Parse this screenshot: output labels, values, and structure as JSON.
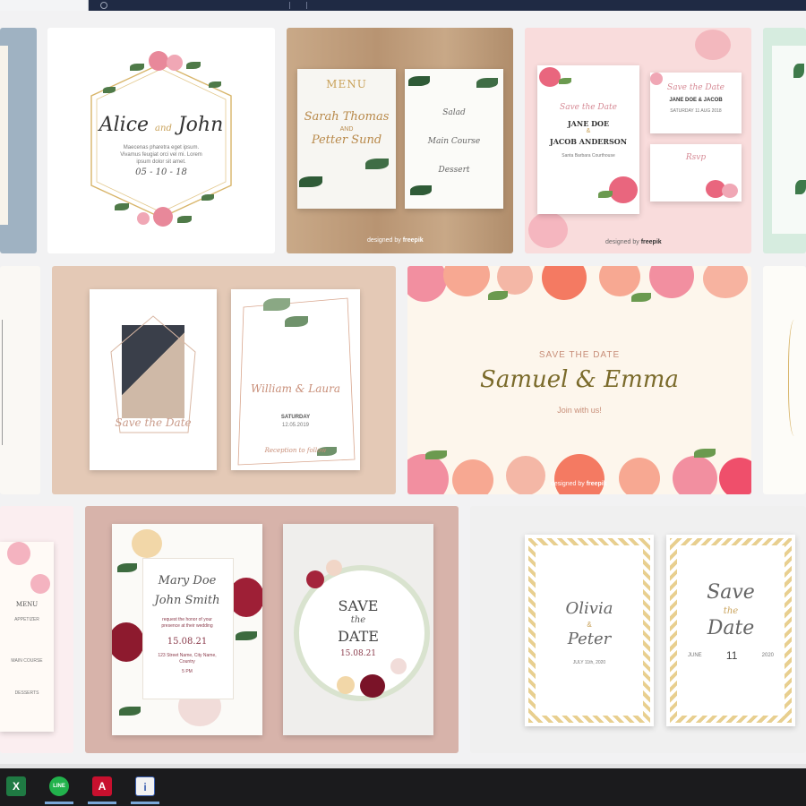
{
  "browser": {
    "tab_icon": "search-icon"
  },
  "thumbnails": {
    "alice": {
      "names": "Alice and John",
      "name1": "Alice",
      "and": "and",
      "name2": "John",
      "body": "Maecenas pharetra eget ipsum. Vivamus feugiat orci vel mi. Lorem ipsum dolor sit amet.",
      "date": "05 - 10 - 18"
    },
    "menu": {
      "menu_label": "MENU",
      "name1": "Sarah Thomas",
      "and": "AND",
      "name2": "Petter Sund",
      "course1": "Salad",
      "course2": "Main Course",
      "course3": "Dessert",
      "credit_prefix": "designed by",
      "credit_brand": "freepik"
    },
    "jane": {
      "save": "Save the Date",
      "name1": "JANE DOE",
      "and": "&",
      "name2": "JACOB ANDERSON",
      "details": "Santa Barbara Courthouse",
      "card2_save": "Save the Date",
      "card2_names": "JANE DOE & JACOB",
      "card2_date": "SATURDAY 11 AUG 2018",
      "rsvp": "Rsvp",
      "credit_prefix": "designed by",
      "credit_brand": "freepik"
    },
    "william": {
      "photo_caption": "Save the Date",
      "names": "William & Laura",
      "day": "SATURDAY",
      "date": "12.05.2019",
      "reception": "Reception to follow"
    },
    "samuel": {
      "save": "SAVE THE DATE",
      "names": "Samuel & Emma",
      "join": "Join with us!",
      "credit_prefix": "designed by",
      "credit_brand": "freepik"
    },
    "menu_left": {
      "menu": "MENU",
      "appetizer": "APPETIZER",
      "main": "MAIN COURSE",
      "desserts": "DESSERTS"
    },
    "mary": {
      "names1": "Mary Doe",
      "names2": "John Smith",
      "invite": "request the honor of your presence at their wedding",
      "date": "15.08.21",
      "address": "123 Street Name, City Name, Country",
      "time": "5 PM",
      "save1": "SAVE",
      "save2": "the",
      "save3": "DATE",
      "date2": "15.08.21"
    },
    "olivia": {
      "name1": "Olivia",
      "and": "&",
      "name2": "Peter",
      "date_line": "JULY 11th, 2020",
      "save": "Save",
      "the": "the",
      "date_word": "Date",
      "month": "JUNE",
      "day": "11",
      "year": "2020"
    }
  },
  "taskbar": {
    "items": [
      {
        "name": "excel-icon",
        "glyph": "X",
        "color": "#1f7a43"
      },
      {
        "name": "line-icon",
        "glyph": "LINE",
        "color": "#22b24c"
      },
      {
        "name": "acrobat-icon",
        "glyph": "A",
        "color": "#c8102e"
      },
      {
        "name": "app-window-icon",
        "glyph": "i",
        "color": "#3b5fb0"
      }
    ]
  },
  "colors": {
    "taskbar": "#1b1b1d",
    "active_indicator": "#7aa7d8"
  }
}
